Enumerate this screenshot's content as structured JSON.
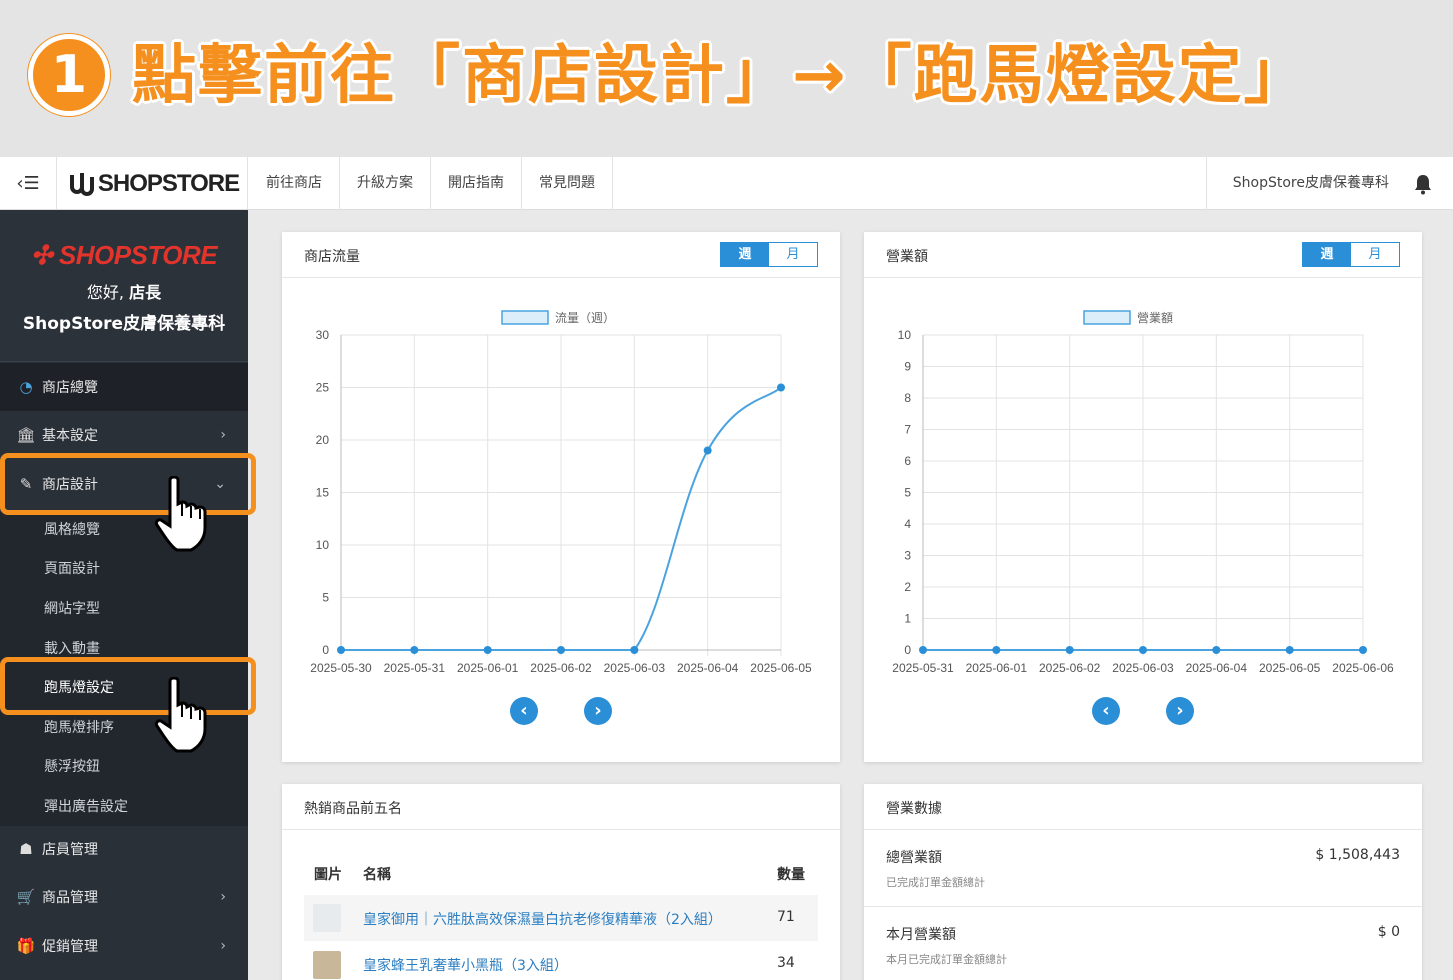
{
  "banner": {
    "step": "1",
    "text": "點擊前往「商店設計」→「跑馬燈設定」"
  },
  "topnav": {
    "brand": "SHOPSTORE",
    "links": [
      "前往商店",
      "升級方案",
      "開店指南",
      "常見問題"
    ],
    "store_name": "ShopStore皮膚保養專科"
  },
  "sidebar": {
    "brand": "SHOPSTORE",
    "hello": "您好,",
    "role": "店長",
    "store_name": "ShopStore皮膚保養專科",
    "items": [
      {
        "label": "商店總覽",
        "icon": "dashboard-icon"
      },
      {
        "label": "基本設定",
        "icon": "bank-icon"
      },
      {
        "label": "商店設計",
        "icon": "magic-wand-icon"
      },
      {
        "label": "店員管理",
        "icon": "users-icon"
      },
      {
        "label": "商品管理",
        "icon": "cart-icon"
      },
      {
        "label": "促銷管理",
        "icon": "gift-icon"
      }
    ],
    "subitems": [
      "風格總覽",
      "頁面設計",
      "網站字型",
      "載入動畫",
      "跑馬燈設定",
      "跑馬燈排序",
      "懸浮按鈕",
      "彈出廣告設定"
    ]
  },
  "traffic": {
    "title": "商店流量",
    "toggle_week": "週",
    "toggle_month": "月",
    "accent": "#2b8fd8"
  },
  "revenue": {
    "title": "營業額",
    "toggle_week": "週",
    "toggle_month": "月"
  },
  "chart_data": [
    {
      "type": "line",
      "title": "",
      "legend": "流量（週）",
      "categories": [
        "2025-05-30",
        "2025-05-31",
        "2025-06-01",
        "2025-06-02",
        "2025-06-03",
        "2025-06-04",
        "2025-06-05"
      ],
      "values": [
        0,
        0,
        0,
        0,
        0,
        19,
        25
      ],
      "ylim": [
        0,
        30
      ],
      "yticks": [
        0,
        5,
        10,
        15,
        20,
        25,
        30
      ],
      "grid": true,
      "legend_position": "top"
    },
    {
      "type": "line",
      "title": "",
      "legend": "營業額",
      "categories": [
        "2025-05-31",
        "2025-06-01",
        "2025-06-02",
        "2025-06-03",
        "2025-06-04",
        "2025-06-05",
        "2025-06-06"
      ],
      "values": [
        0,
        0,
        0,
        0,
        0,
        0,
        0
      ],
      "ylim": [
        0,
        10
      ],
      "yticks": [
        0,
        1,
        2,
        3,
        4,
        5,
        6,
        7,
        8,
        9,
        10
      ],
      "grid": true,
      "legend_position": "top"
    }
  ],
  "top_products": {
    "title": "熱銷商品前五名",
    "col_image": "圖片",
    "col_name": "名稱",
    "col_qty": "數量",
    "rows": [
      {
        "name": "皇家御用｜六胜肽高效保濕量白抗老修復精華液（2入組）",
        "qty": "71"
      },
      {
        "name": "皇家蜂王乳奢華小黑瓶（3入組）",
        "qty": "34"
      }
    ]
  },
  "stats": {
    "title": "營業數據",
    "total_label": "總營業額",
    "total_sub": "已完成訂單金額總計",
    "total_value": "$ 1,508,443",
    "month_label": "本月營業額",
    "month_sub": "本月已完成訂單金額總計",
    "month_value": "$ 0"
  }
}
